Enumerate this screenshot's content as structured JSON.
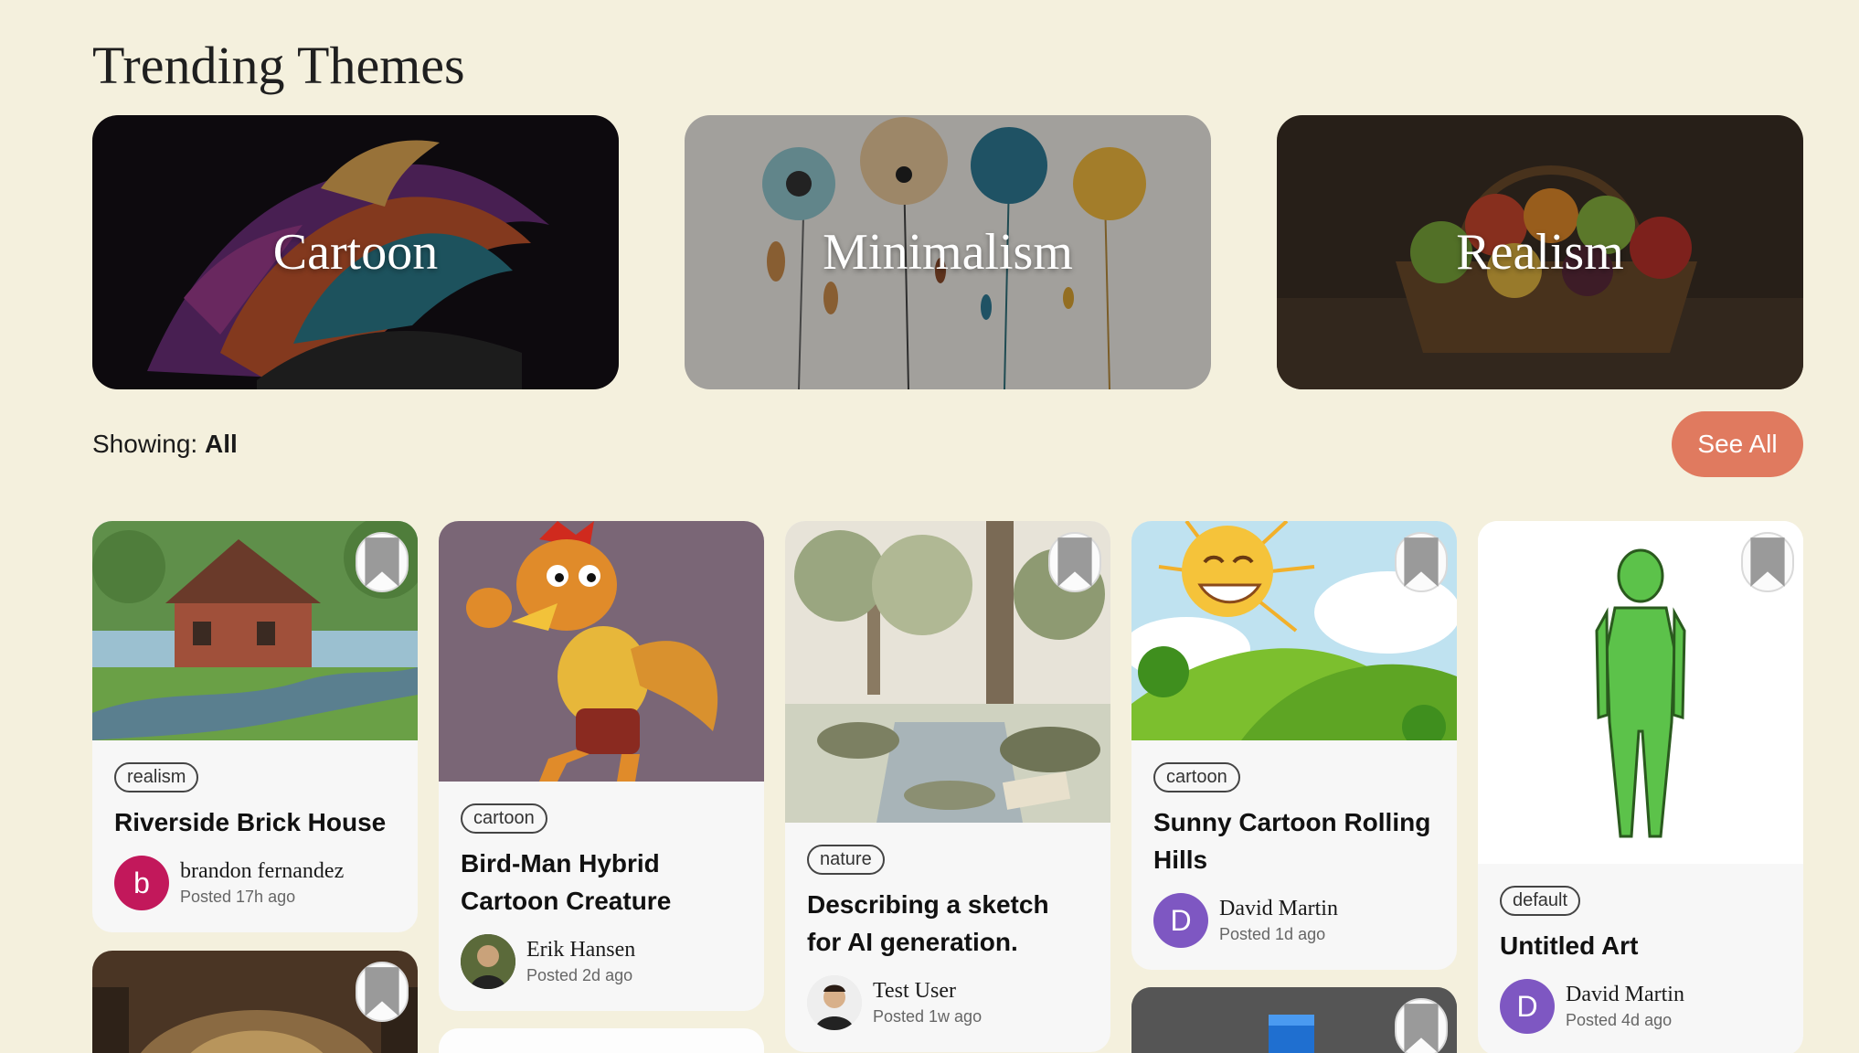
{
  "page": {
    "title": "Trending Themes"
  },
  "themes": [
    {
      "label": "Cartoon"
    },
    {
      "label": "Minimalism"
    },
    {
      "label": "Realism"
    }
  ],
  "filter": {
    "prefix": "Showing:",
    "value": "All"
  },
  "see_all_label": "See All",
  "cards": [
    {
      "tag": "realism",
      "title": "Riverside Brick House",
      "author": "brandon fernandez",
      "avatar_letter": "b",
      "avatar_color": "#c2185b",
      "posted": "Posted 17h ago"
    },
    {
      "tag": "cartoon",
      "title": "Bird-Man Hybrid Cartoon Creature",
      "author": "Erik Hansen",
      "posted": "Posted 2d ago"
    },
    {
      "tag": "nature",
      "title": "Describing a sketch for AI generation.",
      "author": "Test User",
      "posted": "Posted 1w ago"
    },
    {
      "tag": "cartoon",
      "title": "Sunny Cartoon Rolling Hills",
      "author": "David Martin",
      "avatar_letter": "D",
      "avatar_color": "#7e57c2",
      "posted": "Posted 1d ago"
    },
    {
      "tag": "default",
      "title": "Untitled Art",
      "author": "David Martin",
      "avatar_letter": "D",
      "avatar_color": "#7e57c2",
      "posted": "Posted 4d ago"
    }
  ],
  "colors": {
    "background": "#f4f0dd",
    "accent": "#e07a5f"
  }
}
